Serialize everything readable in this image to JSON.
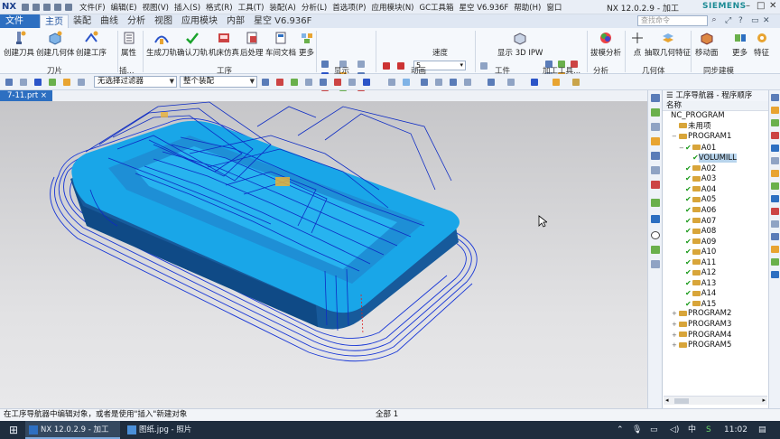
{
  "app": {
    "logo": "NX",
    "title": "NX 12.0.2.9 - 加工",
    "brand": "SIEMENS"
  },
  "menus": [
    "文件(F)",
    "编辑(E)",
    "视图(V)",
    "插入(S)",
    "格式(R)",
    "工具(T)",
    "装配(A)",
    "分析(L)",
    "首选项(P)",
    "应用模块(N)",
    "GC工具箱",
    "星空 V6.936F",
    "帮助(H)",
    "窗口"
  ],
  "tabs": [
    "文件(F)",
    "主页",
    "装配",
    "曲线",
    "分析",
    "视图",
    "应用模块",
    "内部",
    "星空 V6.936F"
  ],
  "search": {
    "placeholder": "查找命令"
  },
  "ribbon": {
    "buttons": [
      "创建刀具",
      "创建几何体",
      "创建工序",
      "属性",
      "生成刀轨",
      "确认刀轨",
      "机床仿真",
      "后处理",
      "车间文档",
      "更多",
      "速度",
      "显示 3D IPW",
      "拔模分析",
      "点",
      "抽取几何特征",
      "移动面",
      "更多",
      "特征"
    ],
    "speed_value": "5",
    "groups": [
      "刀片",
      "插...",
      "工序",
      "显示",
      "动画",
      "工件",
      "加工工具...",
      "分析",
      "几何体",
      "同步建模"
    ]
  },
  "filters": {
    "select_filter": "无选择过滤器",
    "assembly_scope": "整个装配"
  },
  "file_tab": "7-11.prt",
  "navigator": {
    "title": "工序导航器 - 程序顺序",
    "column": "名称",
    "rows": [
      {
        "label": "NC_PROGRAM",
        "level": 0,
        "expand": "",
        "check": "",
        "folder": false
      },
      {
        "label": "未用项",
        "level": 1,
        "expand": "",
        "check": "",
        "folder": true
      },
      {
        "label": "PROGRAM1",
        "level": 1,
        "expand": "−",
        "check": "",
        "folder": true
      },
      {
        "label": "A01",
        "level": 2,
        "expand": "−",
        "check": "✔",
        "folder": true
      },
      {
        "label": "VOLUMILL",
        "level": 3,
        "expand": "",
        "check": "✔",
        "folder": false,
        "selected": true
      },
      {
        "label": "A02",
        "level": 2,
        "expand": "",
        "check": "✔",
        "folder": true
      },
      {
        "label": "A03",
        "level": 2,
        "expand": "",
        "check": "✔",
        "folder": true
      },
      {
        "label": "A04",
        "level": 2,
        "expand": "",
        "check": "✔",
        "folder": true
      },
      {
        "label": "A05",
        "level": 2,
        "expand": "",
        "check": "✔",
        "folder": true
      },
      {
        "label": "A06",
        "level": 2,
        "expand": "",
        "check": "✔",
        "folder": true
      },
      {
        "label": "A07",
        "level": 2,
        "expand": "",
        "check": "✔",
        "folder": true
      },
      {
        "label": "A08",
        "level": 2,
        "expand": "",
        "check": "✔",
        "folder": true
      },
      {
        "label": "A09",
        "level": 2,
        "expand": "",
        "check": "✔",
        "folder": true
      },
      {
        "label": "A10",
        "level": 2,
        "expand": "",
        "check": "✔",
        "folder": true
      },
      {
        "label": "A11",
        "level": 2,
        "expand": "",
        "check": "✔",
        "folder": true
      },
      {
        "label": "A12",
        "level": 2,
        "expand": "",
        "check": "✔",
        "folder": true
      },
      {
        "label": "A13",
        "level": 2,
        "expand": "",
        "check": "✔",
        "folder": true
      },
      {
        "label": "A14",
        "level": 2,
        "expand": "",
        "check": "✔",
        "folder": true
      },
      {
        "label": "A15",
        "level": 2,
        "expand": "",
        "check": "✔",
        "folder": true
      },
      {
        "label": "PROGRAM2",
        "level": 1,
        "expand": "+",
        "check": "",
        "folder": true
      },
      {
        "label": "PROGRAM3",
        "level": 1,
        "expand": "+",
        "check": "",
        "folder": true
      },
      {
        "label": "PROGRAM4",
        "level": 1,
        "expand": "+",
        "check": "",
        "folder": true
      },
      {
        "label": "PROGRAM5",
        "level": 1,
        "expand": "+",
        "check": "",
        "folder": true
      }
    ]
  },
  "status": {
    "message": "在工序导航器中编辑对象，或者是使用\"插入\"新建对象",
    "center": "全部 1"
  },
  "taskbar": {
    "items": [
      "NX 12.0.2.9 - 加工",
      "图纸.jpg - 照片"
    ],
    "ime": "中",
    "clock": "11:02"
  },
  "colors": {
    "accent": "#2d6fc1",
    "toolpath": "#1736d6",
    "part": "#19a6e8"
  }
}
